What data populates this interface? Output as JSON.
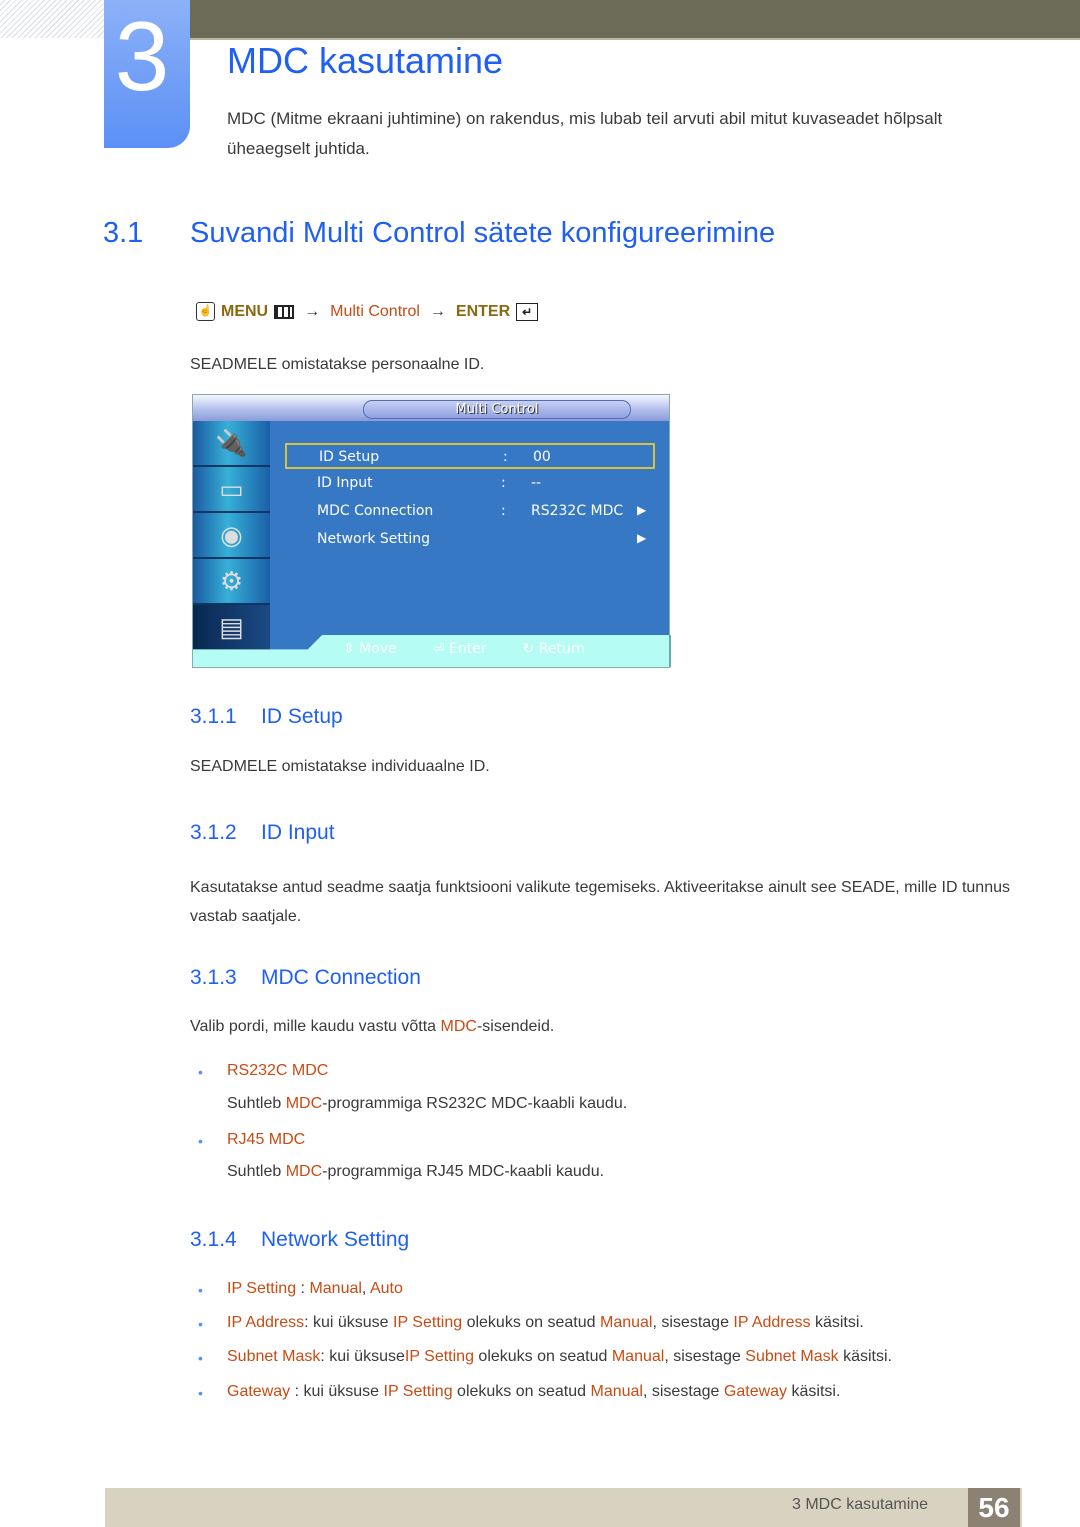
{
  "chapter": {
    "number": "3",
    "title": "MDC kasutamine",
    "intro": "MDC (Mitme ekraani juhtimine) on rakendus, mis lubab teil arvuti abil mitut kuvaseadet hõlpsalt üheaegselt juhtida."
  },
  "section": {
    "number": "3.1",
    "title": "Suvandi Multi Control sätete konfigureerimine",
    "path": {
      "hand_icon": "hand-icon",
      "menu_label": "MENU",
      "menu_icon": "menu-icon",
      "arrow1": "→",
      "item": "Multi Control",
      "arrow2": "→",
      "enter_label": "ENTER",
      "enter_icon": "enter-icon"
    },
    "description": "SEADMELE omistatakse personaalne ID."
  },
  "osd": {
    "title": "Multi Control",
    "side_icons": [
      "input-plug-icon",
      "picture-icon",
      "sound-icon",
      "setup-gear-icon",
      "multi-control-icon"
    ],
    "rows": [
      {
        "label": "ID Setup",
        "colon": ":",
        "value": "00",
        "arrow": ""
      },
      {
        "label": "ID Input",
        "colon": ":",
        "value": "--",
        "arrow": ""
      },
      {
        "label": "MDC Connection",
        "colon": ":",
        "value": "RS232C MDC",
        "arrow": "▶"
      },
      {
        "label": "Network Setting",
        "colon": "",
        "value": "",
        "arrow": "▶"
      }
    ],
    "bottom": {
      "move_icon": "⇕",
      "move": "Move",
      "enter_icon": "⏎",
      "enter": "Enter",
      "return_icon": "↻",
      "return": "Return"
    }
  },
  "subsections": [
    {
      "number": "3.1.1",
      "title": "ID Setup",
      "text": "SEADMELE omistatakse individuaalne ID."
    },
    {
      "number": "3.1.2",
      "title": "ID Input",
      "text": "Kasutatakse antud seadme saatja funktsiooni valikute tegemiseks. Aktiveeritakse ainult see SEADE, mille ID tunnus vastab saatjale."
    },
    {
      "number": "3.1.3",
      "title": "MDC Connection",
      "text_pre": "Valib pordi, mille kaudu vastu võtta ",
      "text_hl": "MDC",
      "text_post": "-sisendeid.",
      "options": [
        {
          "name": "RS232C MDC",
          "desc_pre": "Suhtleb ",
          "desc_hl": "MDC",
          "desc_post": "-programmiga RS232C MDC-kaabli kaudu."
        },
        {
          "name": "RJ45 MDC",
          "desc_pre": "Suhtleb ",
          "desc_hl": "MDC",
          "desc_post": "-programmiga RJ45 MDC-kaabli kaudu."
        }
      ]
    },
    {
      "number": "3.1.4",
      "title": "Network Setting",
      "bullets": [
        {
          "a": "IP Setting",
          "b": " : ",
          "c": "Manual",
          "d": ", ",
          "e": "Auto"
        },
        {
          "a": "IP Address",
          "b": ": kui üksuse ",
          "c": "IP Setting",
          "d": " olekuks on seatud ",
          "e": "Manual",
          "f": ", sisestage ",
          "g": "IP Address",
          "h": " käsitsi."
        },
        {
          "a": "Subnet Mask",
          "b": ": kui üksuse",
          "c": "IP Setting",
          "d": " olekuks on seatud ",
          "e": "Manual",
          "f": ", sisestage ",
          "g": "Subnet Mask",
          "h": " käsitsi."
        },
        {
          "a": "Gateway",
          "b": " : kui üksuse ",
          "c": "IP Setting",
          "d": " olekuks on seatud ",
          "e": "Manual",
          "f": ", sisestage ",
          "g": "Gateway",
          "h": " käsitsi."
        }
      ]
    }
  ],
  "footer": {
    "chapter_label": "3 MDC kasutamine",
    "page": "56"
  }
}
